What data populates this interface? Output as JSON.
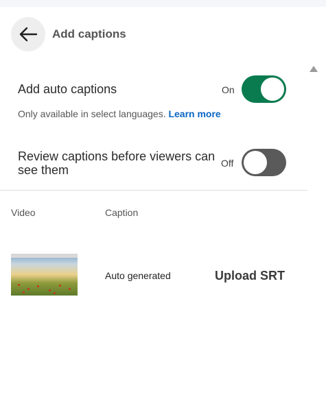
{
  "header": {
    "title": "Add captions"
  },
  "auto_captions": {
    "label": "Add auto captions",
    "state_label": "On",
    "enabled": true,
    "hint": "Only available in select languages.",
    "learn_more": "Learn more"
  },
  "review_captions": {
    "label": "Review captions before viewers can see them",
    "state_label": "Off",
    "enabled": false
  },
  "table": {
    "headers": {
      "video": "Video",
      "caption": "Caption"
    },
    "row": {
      "caption_status": "Auto generated",
      "upload_label": "Upload SRT"
    }
  },
  "colors": {
    "toggle_on": "#0a7b4f",
    "toggle_off": "#5a5a5a",
    "link": "#0a66c2"
  }
}
